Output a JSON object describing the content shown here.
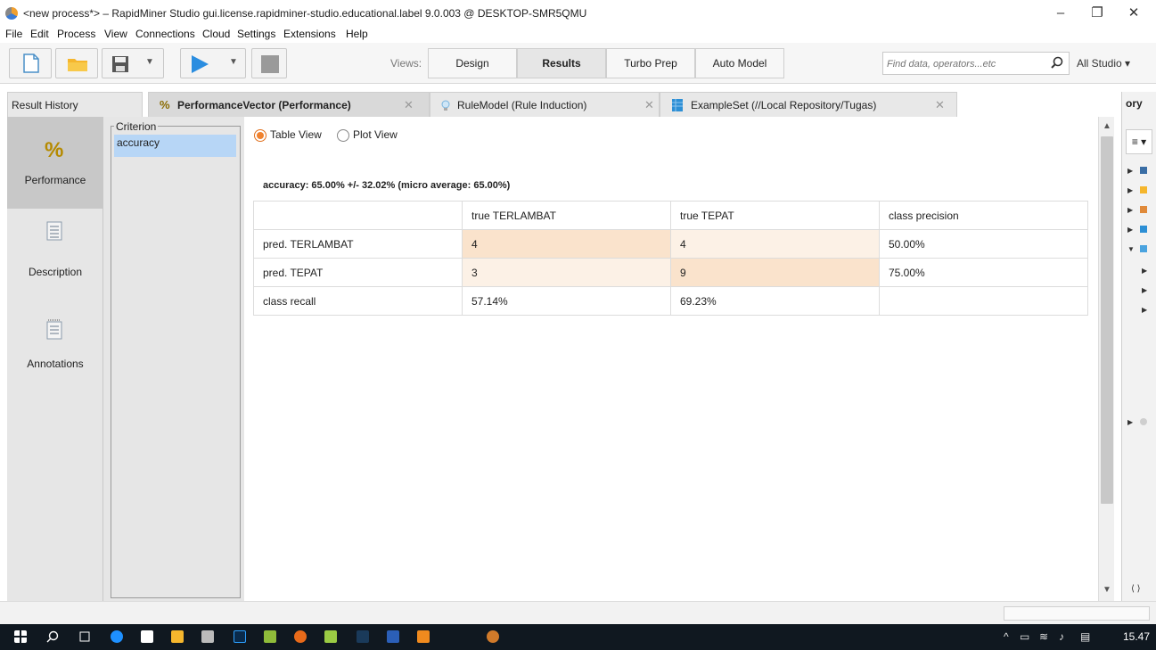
{
  "window": {
    "title": "<new process*> – RapidMiner Studio gui.license.rapidminer-studio.educational.label 9.0.003 @ DESKTOP-SMR5QMU",
    "minimize": "–",
    "restore": "❐",
    "close": "✕"
  },
  "menu": [
    "File",
    "Edit",
    "Process",
    "View",
    "Connections",
    "Cloud",
    "Settings",
    "Extensions",
    "Help"
  ],
  "toolbar": {
    "views_label": "Views:",
    "views": [
      "Design",
      "Results",
      "Turbo Prep",
      "Auto Model"
    ],
    "active_view": "Results",
    "search_placeholder": "Find data, operators...etc",
    "studio_select": "All Studio ▾"
  },
  "tabs": {
    "result_history": "Result History",
    "items": [
      {
        "label": "PerformanceVector (Performance)",
        "close": "✕"
      },
      {
        "label": "RuleModel (Rule Induction)",
        "close": "✕"
      },
      {
        "label": "ExampleSet (//Local Repository/Tugas)",
        "close": "✕"
      }
    ]
  },
  "sidenav": [
    "Performance",
    "Description",
    "Annotations"
  ],
  "criterion": {
    "legend": "Criterion",
    "selected": "accuracy"
  },
  "view_mode": {
    "table_view": "Table View",
    "plot_view": "Plot View"
  },
  "performance": {
    "heading": "accuracy: 65.00% +/- 32.02% (micro average: 65.00%)",
    "columns": [
      "",
      "true TERLAMBAT",
      "true TEPAT",
      "class precision"
    ],
    "rows": [
      [
        "pred. TERLAMBAT",
        "4",
        "4",
        "50.00%"
      ],
      [
        "pred. TEPAT",
        "3",
        "9",
        "75.00%"
      ],
      [
        "class recall",
        "57.14%",
        "69.23%",
        ""
      ]
    ]
  },
  "right_panel": {
    "title": "ory",
    "menu_button": "≡ ▾"
  },
  "taskbar": {
    "clock": "15.47"
  },
  "colors": {
    "accent": "#f0822e",
    "selection": "#b7d6f6",
    "cell_highlight": "#fae3cc"
  }
}
